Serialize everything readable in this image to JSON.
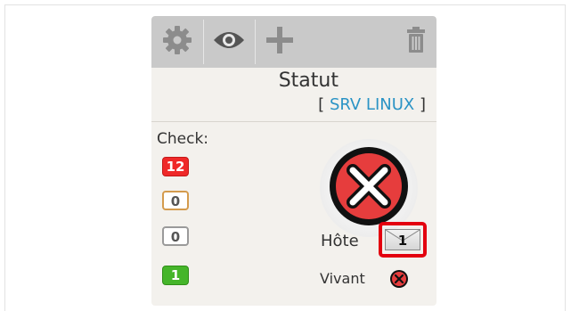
{
  "toolbar": {
    "icons": [
      "gear-icon",
      "eye-icon",
      "plus-icon",
      "trash-icon"
    ]
  },
  "card": {
    "title": "Statut",
    "subtitle": {
      "open_bracket": "[",
      "host": "SRV LINUX",
      "close_bracket": "]"
    }
  },
  "check": {
    "label": "Check:",
    "counts": [
      {
        "value": "12",
        "status": "critical",
        "color": "#ef2929"
      },
      {
        "value": "0",
        "status": "warning",
        "color": "#d49b4d"
      },
      {
        "value": "0",
        "status": "unknown",
        "color": "#9a9a9a"
      },
      {
        "value": "1",
        "status": "ok",
        "color": "#45b52a"
      }
    ]
  },
  "status": {
    "icon": "x-circle-icon",
    "host_label": "Hôte",
    "host_notification_count": "1",
    "alive_label": "Vivant",
    "alive_icon": "x-circle-small-icon"
  },
  "colors": {
    "host_link": "#2a93c5",
    "highlight": "#e3000f",
    "status_critical": "#e63d3d"
  }
}
